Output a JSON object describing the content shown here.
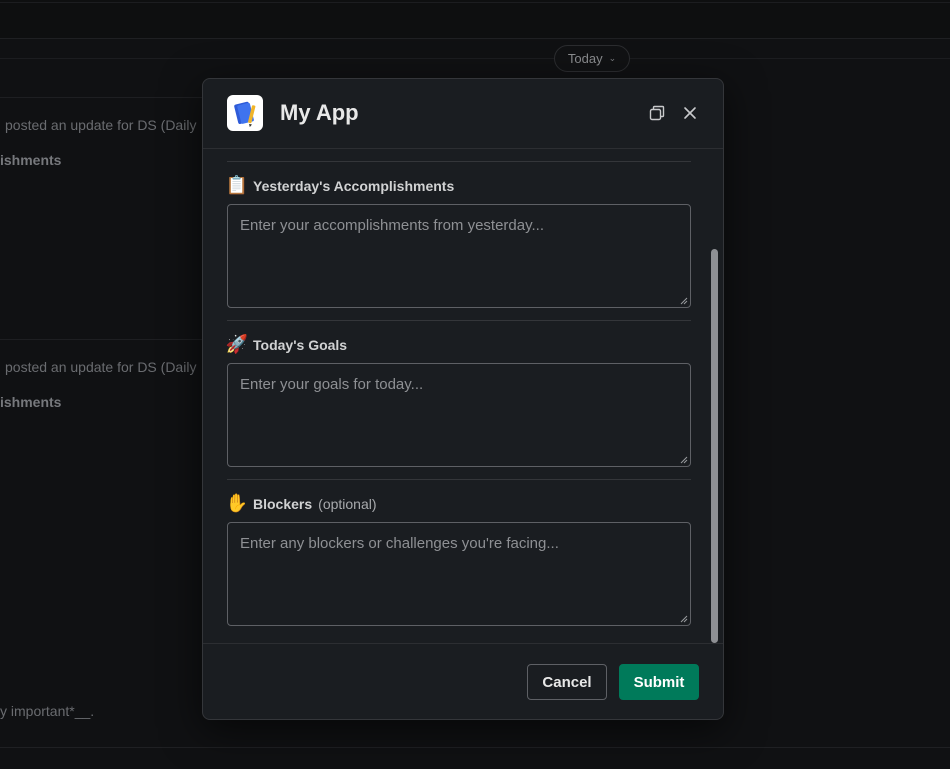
{
  "background": {
    "date_pill": {
      "label": "Today"
    },
    "messages": [
      {
        "text": "posted an update for DS (Daily",
        "heading": "ishments"
      },
      {
        "text": "posted an update for DS (Daily",
        "heading": "ishments"
      }
    ],
    "footer_text": "y important*__."
  },
  "modal": {
    "title": "My App",
    "fields": [
      {
        "emoji": "📋",
        "label": "Yesterday's Accomplishments",
        "optional": "",
        "placeholder": "Enter your accomplishments from yesterday..."
      },
      {
        "emoji": "🚀",
        "label": "Today's Goals",
        "optional": "",
        "placeholder": "Enter your goals for today..."
      },
      {
        "emoji": "✋",
        "label": "Blockers",
        "optional": "(optional)",
        "placeholder": "Enter any blockers or challenges you're facing..."
      }
    ],
    "buttons": {
      "cancel": "Cancel",
      "submit": "Submit"
    }
  },
  "colors": {
    "submit": "#007a5a",
    "modal_bg": "#1a1d21",
    "page_bg": "#101113"
  },
  "icons": {
    "app": "notebook-pencil-icon",
    "expand": "expand-window-icon",
    "close": "close-icon"
  }
}
